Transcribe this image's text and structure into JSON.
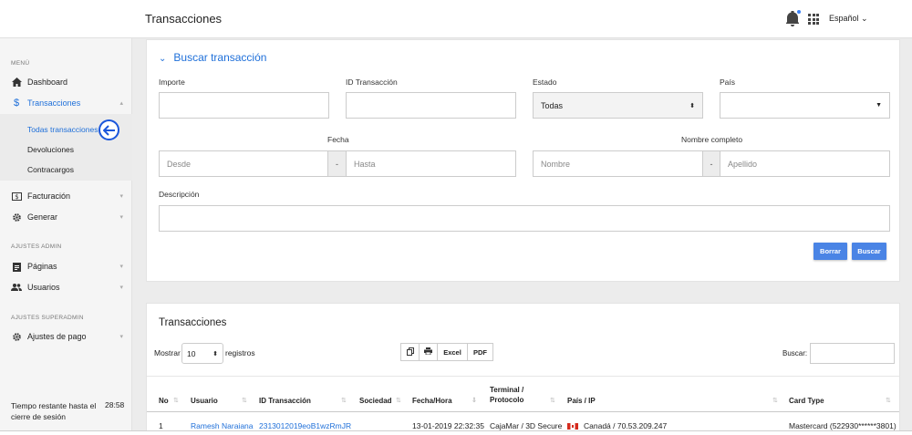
{
  "header": {
    "title": "Transacciones",
    "language": "Español"
  },
  "sidebar": {
    "menu_label": "MENÚ",
    "items": [
      {
        "label": "Dashboard"
      },
      {
        "label": "Transacciones"
      },
      {
        "label": "Facturación"
      },
      {
        "label": "Generar"
      }
    ],
    "sub_items": [
      {
        "label": "Todas transacciones"
      },
      {
        "label": "Devoluciones"
      },
      {
        "label": "Contracargos"
      }
    ],
    "admin_label": "AJUSTES ADMIN",
    "admin_items": [
      {
        "label": "Páginas"
      },
      {
        "label": "Usuarios"
      }
    ],
    "superadmin_label": "AJUSTES SUPERADMIN",
    "superadmin_items": [
      {
        "label": "Ajustes de pago"
      }
    ],
    "session_text": "Tiempo restante hasta el cierre de sesión",
    "session_time": "28:58"
  },
  "search": {
    "title": "Buscar transacción",
    "importe_label": "Importe",
    "id_label": "ID Transacción",
    "estado_label": "Estado",
    "estado_value": "Todas",
    "pais_label": "País",
    "fecha_label": "Fecha",
    "desde_placeholder": "Desde",
    "hasta_placeholder": "Hasta",
    "dash": "-",
    "nombre_label": "Nombre completo",
    "nombre_placeholder": "Nombre",
    "apellido_placeholder": "Apellido",
    "descripcion_label": "Descripción",
    "borrar": "Borrar",
    "buscar": "Buscar"
  },
  "table": {
    "title": "Transacciones",
    "mostrar": "Mostrar",
    "page_length": "10",
    "registros": "registros",
    "export_excel": "Excel",
    "export_pdf": "PDF",
    "search_label": "Buscar:",
    "columns": {
      "no": "No",
      "usuario": "Usuario",
      "id": "ID Transacción",
      "sociedad": "Sociedad",
      "fecha": "Fecha/Hora",
      "terminal_1": "Terminal /",
      "terminal_2": "Protocolo",
      "pais": "País / IP",
      "card": "Card Type"
    },
    "rows": [
      {
        "no": "1",
        "usuario": "Ramesh Naraiana",
        "id": "2313012019eoB1wzRmJR",
        "sociedad": "",
        "fecha": "13-01-2019 22:32:35",
        "terminal": "CajaMar / 3D Secure",
        "pais": "Canadá / 70.53.209.247",
        "card": "Mastercard (522930******3801)"
      }
    ]
  },
  "colors": {
    "accent": "#1e6fd9",
    "button": "#4a84e5",
    "arrow_ring": "#1a56db"
  }
}
